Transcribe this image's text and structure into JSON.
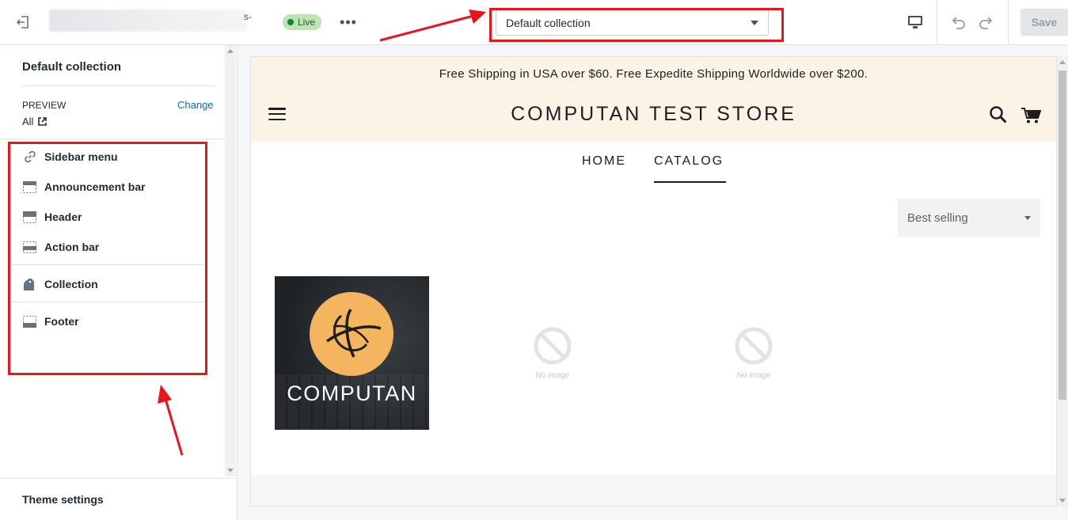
{
  "topbar": {
    "theme_name_fragment": "s-",
    "live_label": "Live",
    "more_label": "•••",
    "template_select_value": "Default collection",
    "save_label": "Save"
  },
  "sidebar": {
    "title": "Default collection",
    "preview_label": "PREVIEW",
    "change_link": "Change",
    "preview_value": "All",
    "sections": [
      {
        "label": "Sidebar menu",
        "icon": "link-icon"
      },
      {
        "label": "Announcement bar",
        "icon": "announcement-bar-icon"
      },
      {
        "label": "Header",
        "icon": "header-icon"
      },
      {
        "label": "Action bar",
        "icon": "action-bar-icon"
      },
      {
        "label": "Collection",
        "icon": "tags-icon"
      },
      {
        "label": "Footer",
        "icon": "footer-icon"
      }
    ],
    "theme_settings": "Theme settings"
  },
  "preview": {
    "announcement": "Free Shipping in USA over $60. Free Expedite Shipping Worldwide over $200.",
    "store_title": "COMPUTAN TEST STORE",
    "nav": [
      "HOME",
      "CATALOG"
    ],
    "sort_value": "Best selling",
    "product_logo_text": "COMPUTAN",
    "no_image_label": "No image"
  },
  "colors": {
    "highlight": "#e8161c",
    "live_badge": "#bbe5b3",
    "announcement_bg": "#faf3e6",
    "link": "#006fbb"
  }
}
